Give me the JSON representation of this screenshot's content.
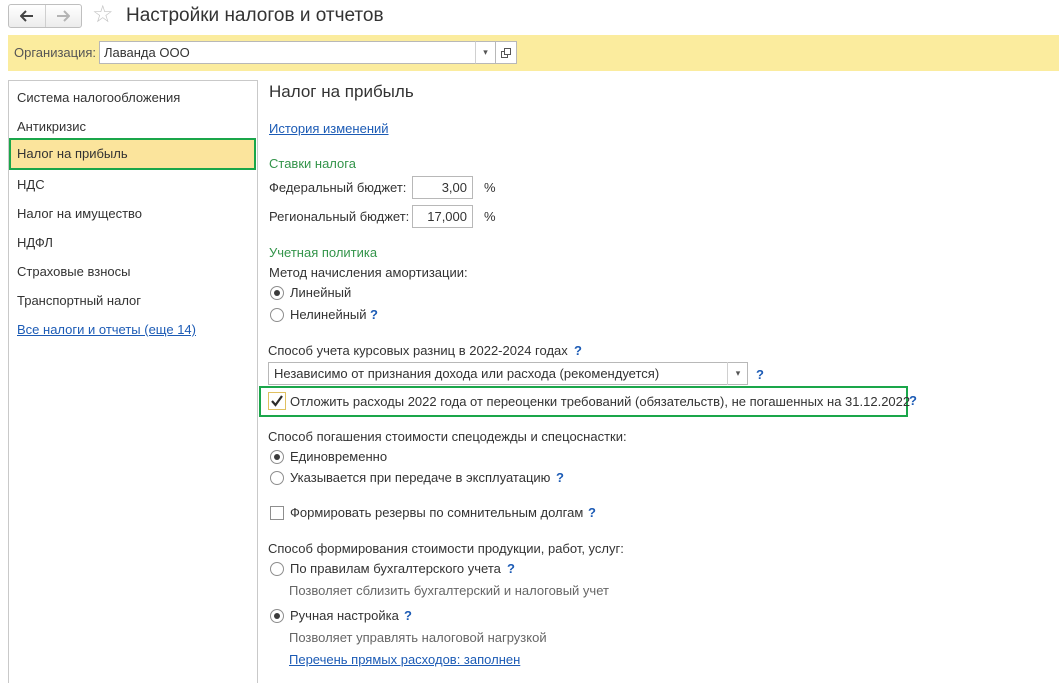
{
  "window": {
    "title": "Настройки налогов и отчетов",
    "back_icon": "arrow-left-icon",
    "forward_icon": "arrow-right-icon",
    "favorite_icon": "star-icon"
  },
  "org": {
    "label": "Организация:",
    "value": "Лаванда ООО"
  },
  "sidebar": {
    "items": [
      {
        "label": "Система налогообложения"
      },
      {
        "label": "Антикризис"
      },
      {
        "label": "Налог на прибыль",
        "active": true
      },
      {
        "label": "НДС"
      },
      {
        "label": "Налог на имущество"
      },
      {
        "label": "НДФЛ"
      },
      {
        "label": "Страховые взносы"
      },
      {
        "label": "Транспортный налог"
      }
    ],
    "all_link": "Все налоги и отчеты (еще 14)"
  },
  "main": {
    "heading": "Налог на прибыль",
    "history_link": "История изменений",
    "rates": {
      "title": "Ставки налога",
      "federal_label": "Федеральный бюджет:",
      "federal_value": "3,00",
      "regional_label": "Региональный бюджет:",
      "regional_value": "17,000",
      "unit": "%"
    },
    "policy": {
      "title": "Учетная политика",
      "depreciation_label": "Метод начисления амортизации:",
      "linear": "Линейный",
      "nonlinear": "Нелинейный",
      "exchange_label": "Способ учета курсовых разниц в 2022-2024 годах",
      "exchange_value": "Независимо от признания дохода или расхода (рекомендуется)",
      "defer_label": "Отложить расходы 2022 года от переоценки требований (обязательств), не погашенных на 31.12.2022",
      "workwear_label": "Способ погашения стоимости спецодежды и спецоснастки:",
      "workwear_once": "Единовременно",
      "workwear_transfer": "Указывается при передаче в эксплуатацию",
      "reserves_label": "Формировать резервы по сомнительным долгам",
      "cost_label": "Способ формирования стоимости продукции, работ, услуг:",
      "cost_accounting": "По правилам бухгалтерского учета",
      "cost_accounting_hint": "Позволяет сблизить бухгалтерский и налоговый учет",
      "cost_manual": "Ручная настройка",
      "cost_manual_hint": "Позволяет управлять налоговой нагрузкой",
      "direct_costs_link": "Перечень прямых расходов: заполнен"
    },
    "help": "?",
    "dropdown_arrow": "▾"
  },
  "colors": {
    "highlight_border": "#1aa64a",
    "org_bar": "#fbec9e",
    "section_title": "#33944a",
    "link": "#1c5bb5"
  }
}
